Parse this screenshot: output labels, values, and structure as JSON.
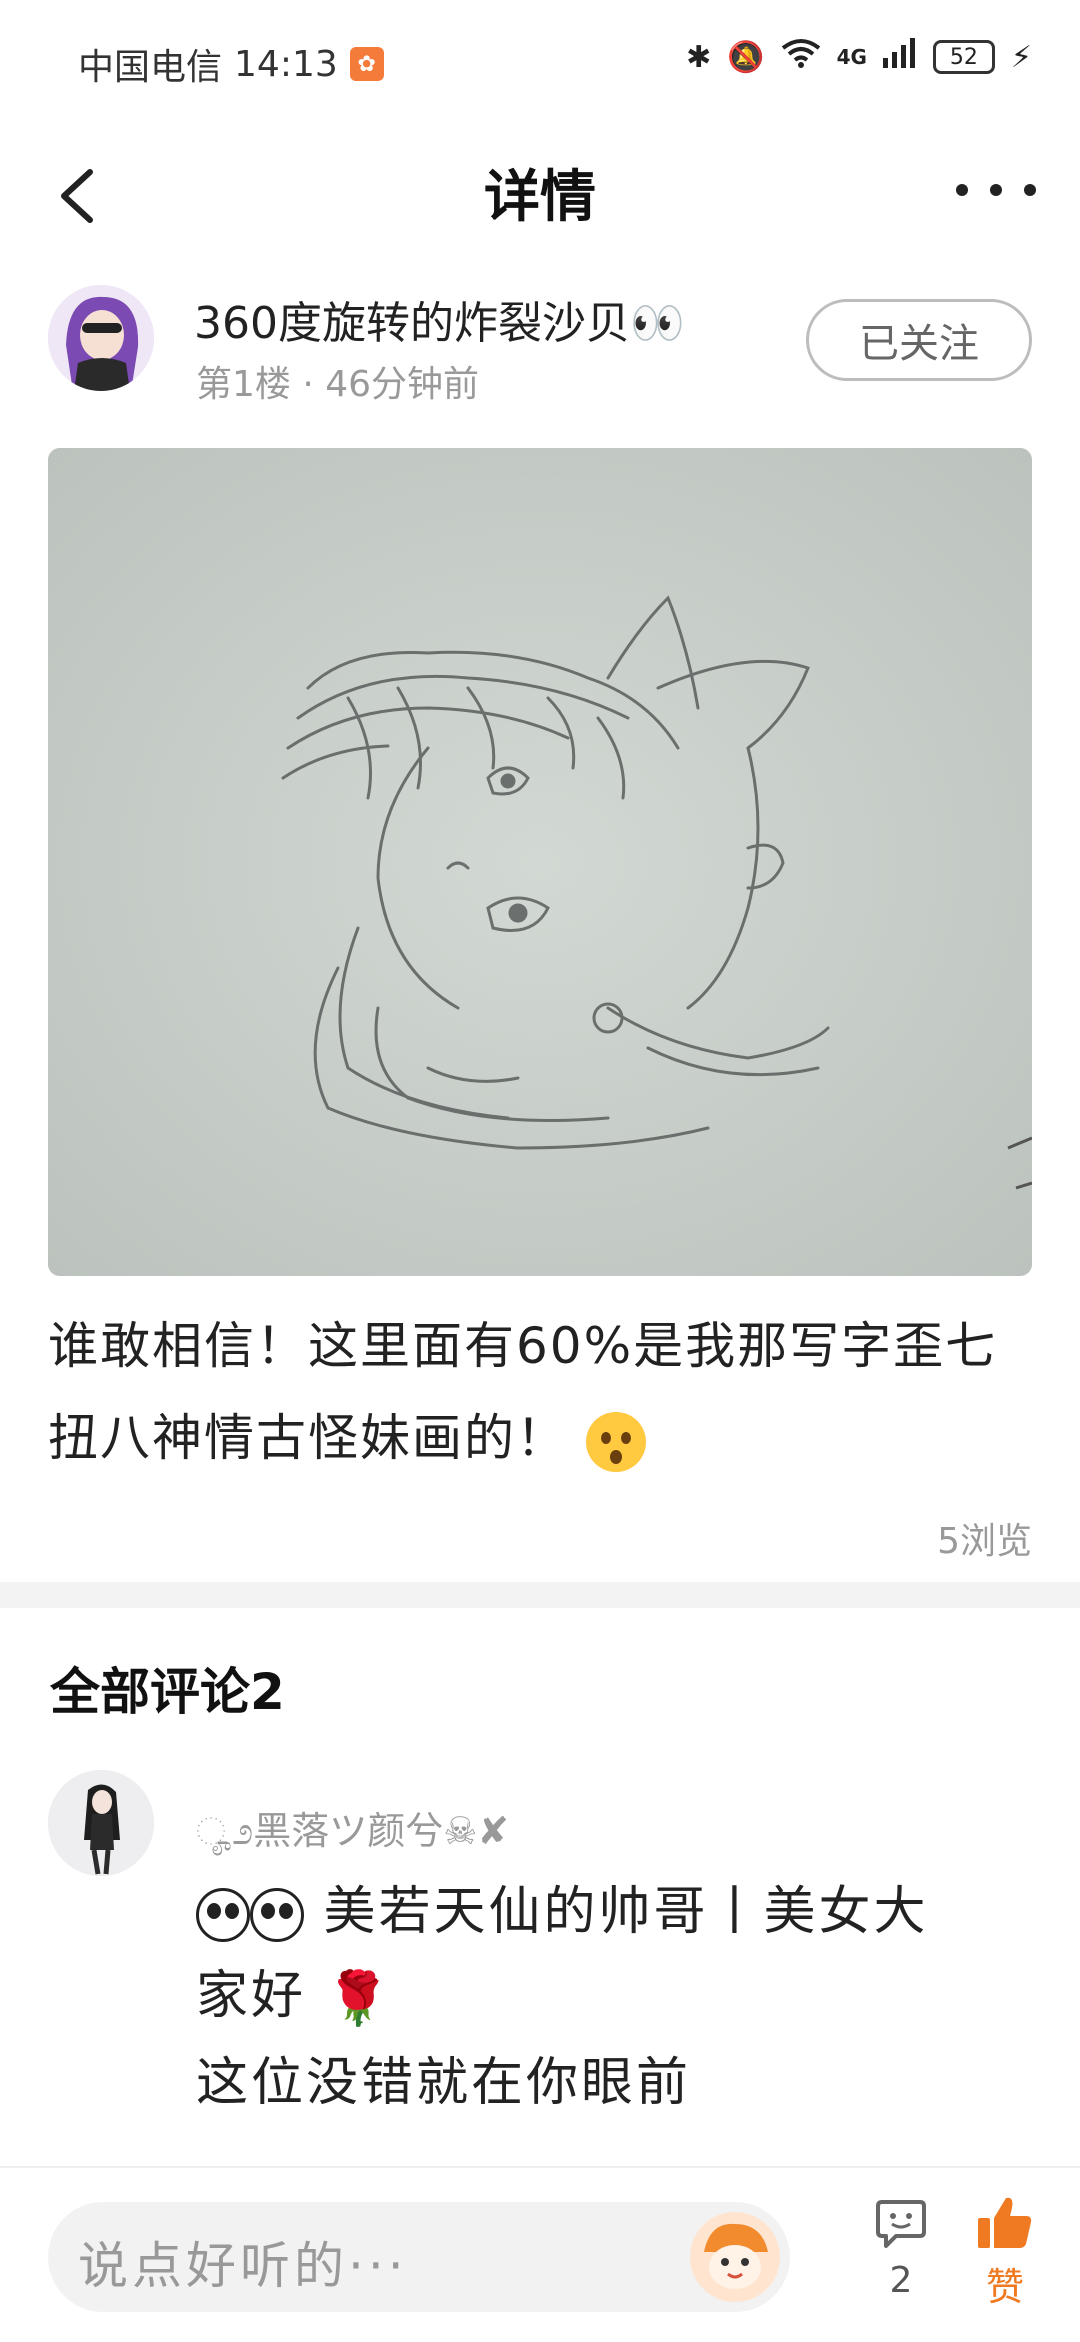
{
  "status_bar": {
    "carrier": "中国电信",
    "time": "14:13",
    "network": "4G",
    "battery": "52"
  },
  "header": {
    "title": "详情"
  },
  "author": {
    "name": "360度旋转的炸裂沙贝👀",
    "floor": "第1楼",
    "time_ago": "46分钟前",
    "follow_label": "已关注"
  },
  "post": {
    "text_line1": "谁敢相信！这里面有60%是我那写字歪七",
    "text_line2": "扭八神情古怪妹画的！",
    "views": "5浏览"
  },
  "comments": {
    "title": "全部评论2",
    "items": [
      {
        "username": "ೄ೨黑落ツ颜兮☠✘",
        "line1": "美若天仙的帅哥丨美女大",
        "line2": "家好",
        "line3": "这位没错就在你眼前"
      }
    ]
  },
  "bottom_bar": {
    "input_placeholder": "说点好听的···",
    "comment_count": "2",
    "like_label": "赞"
  },
  "colors": {
    "accent": "#f07a22",
    "muted": "#999999"
  }
}
